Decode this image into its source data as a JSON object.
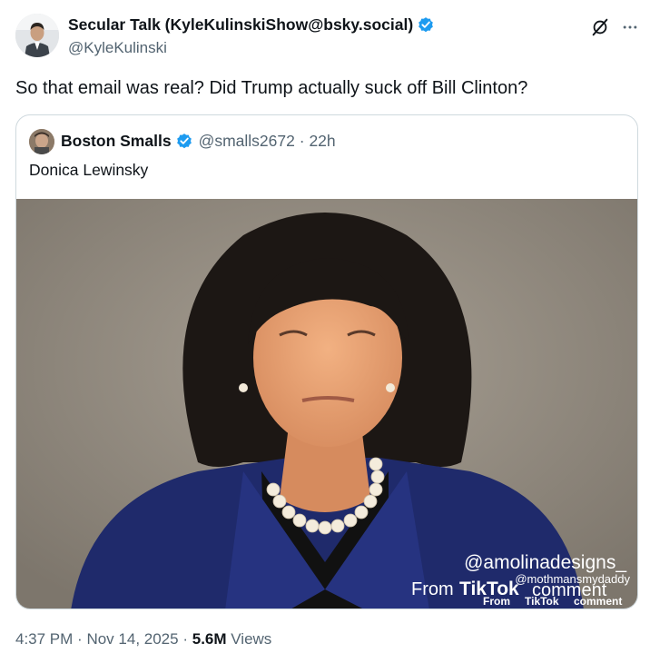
{
  "tweet": {
    "author_name": "Secular Talk (KyleKulinskiShow@bsky.social)",
    "author_handle": "@KyleKulinski",
    "verified": true,
    "text": "So that email was real? Did Trump actually suck off Bill Clinton?",
    "icons": {
      "grok": "grok-icon",
      "more": "more-icon",
      "verified": "verified-badge-icon"
    },
    "colors": {
      "verified": "#1d9bf0",
      "secondary_text": "#536471",
      "border": "#cfd9de"
    }
  },
  "quote": {
    "author_name": "Boston Smalls",
    "author_handle": "@smalls2672",
    "separator": "·",
    "time_ago": "22h",
    "text": "Donica Lewinsky",
    "media": {
      "watermark_handle": "@amolinadesigns_",
      "from_label": "From",
      "tiktok_label": "TikTok",
      "comment_handle": "@mothmansmydaddy",
      "comment_label": "comment"
    }
  },
  "footer": {
    "time": "4:37 PM",
    "separator": "·",
    "date": "Nov 14, 2025",
    "views_count": "5.6M",
    "views_label": "Views"
  }
}
